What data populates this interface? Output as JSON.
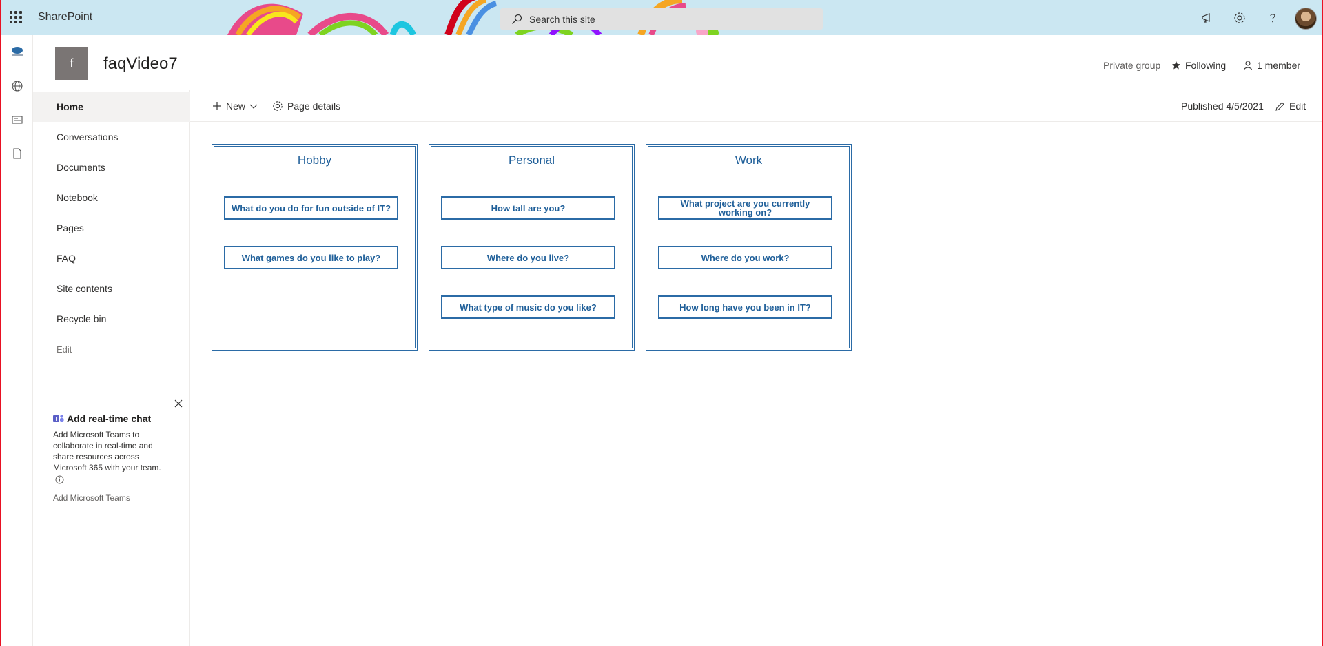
{
  "suite": {
    "brand": "SharePoint",
    "search_placeholder": "Search this site"
  },
  "site": {
    "logo_letter": "f",
    "title": "faqVideo7",
    "privacy": "Private group",
    "follow_label": "Following",
    "members_label": "1 member"
  },
  "nav": {
    "items": [
      {
        "label": "Home",
        "selected": true
      },
      {
        "label": "Conversations"
      },
      {
        "label": "Documents"
      },
      {
        "label": "Notebook"
      },
      {
        "label": "Pages"
      },
      {
        "label": "FAQ"
      },
      {
        "label": "Site contents"
      },
      {
        "label": "Recycle bin"
      },
      {
        "label": "Edit"
      }
    ]
  },
  "promo": {
    "title": "Add real-time chat",
    "body": "Add Microsoft Teams to collaborate in real-time and share resources across Microsoft 365 with your team.",
    "link": "Add Microsoft Teams"
  },
  "command_bar": {
    "new_label": "New",
    "page_details_label": "Page details",
    "published": "Published 4/5/2021",
    "edit_label": "Edit"
  },
  "categories": [
    {
      "title": "Hobby",
      "questions": [
        "What do you do for fun outside of IT?",
        "What games do you like to play?"
      ]
    },
    {
      "title": "Personal",
      "questions": [
        "How tall are you?",
        "Where do you live?",
        "What type of music do you like?"
      ]
    },
    {
      "title": "Work",
      "questions": [
        "What project are you currently working on?",
        "Where do you work?",
        "How long have you been in IT?"
      ]
    }
  ],
  "colors": {
    "suitebar_bg": "#cbe7f2",
    "accent_link": "#1f5f99",
    "box_border": "#2b6ba6",
    "nav_selected_bg": "#f3f2f1",
    "site_logo_bg": "#7a7574"
  }
}
